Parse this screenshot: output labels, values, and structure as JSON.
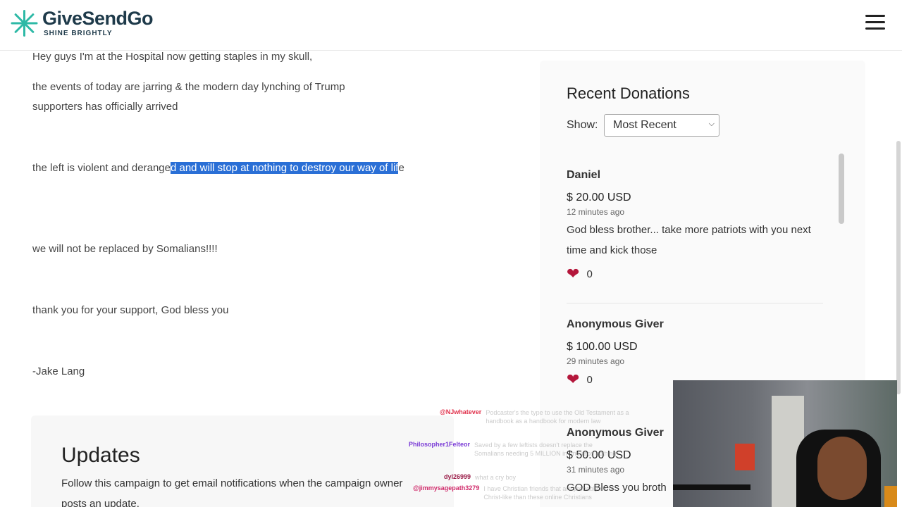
{
  "header": {
    "logo_name": "GiveSendGo",
    "logo_tagline": "SHINE BRIGHTLY"
  },
  "story": {
    "line1": "Hey guys I'm at the Hospital now getting staples in my skull,",
    "line2": "the events of today are jarring & the modern day lynching of Trump supporters has officially arrived",
    "line3_plain": "the left is violent and derange",
    "line3_selected": "d and will stop at nothing to destroy our way of lif",
    "line3_tail": "e",
    "line4": "we will not be replaced by Somalians!!!!",
    "line5": "thank you for your support, God bless you",
    "signature": "-Jake Lang"
  },
  "donations": {
    "title": "Recent Donations",
    "show_label": "Show:",
    "show_value": "Most Recent",
    "items": [
      {
        "name": "Daniel",
        "amount": "$ 20.00 USD",
        "time": "12 minutes ago",
        "message": "God bless brother... take more patriots with you next time and kick those",
        "likes": "0"
      },
      {
        "name": "Anonymous Giver",
        "amount": "$ 100.00 USD",
        "time": "29 minutes ago",
        "message": "",
        "likes": "0"
      },
      {
        "name": "Anonymous Giver",
        "amount": "$ 50.00 USD",
        "time": "31 minutes ago",
        "message": "GOD Bless you broth",
        "likes": ""
      }
    ]
  },
  "updates": {
    "title": "Updates",
    "description": "Follow this campaign to get email notifications when the campaign owner posts an update."
  },
  "chat": [
    {
      "user": "@NJwhatever",
      "color": "#e0304a",
      "message": "Podcaster's the type to use the Old Testament as a handbook as a handbook for modern law"
    },
    {
      "user": "Philosopher1Felteor",
      "color": "#7a3bd6",
      "message": "Saved by a few leftists doesn't replace the Somalians needing 5 MILLION in one race nothing"
    },
    {
      "user": "dyl26999",
      "color": "#9b1f4a",
      "message": "what a cry boy"
    },
    {
      "user": "@jimmysagepath3279",
      "color": "#d02a6a",
      "message": "I have Christian friends that are probably more Christ-like than these online Christians"
    }
  ],
  "colors": {
    "brand_teal": "#2db9a6",
    "brand_navy": "#1e3a4a",
    "highlight": "#2a6fd6",
    "heart": "#b4163b"
  }
}
